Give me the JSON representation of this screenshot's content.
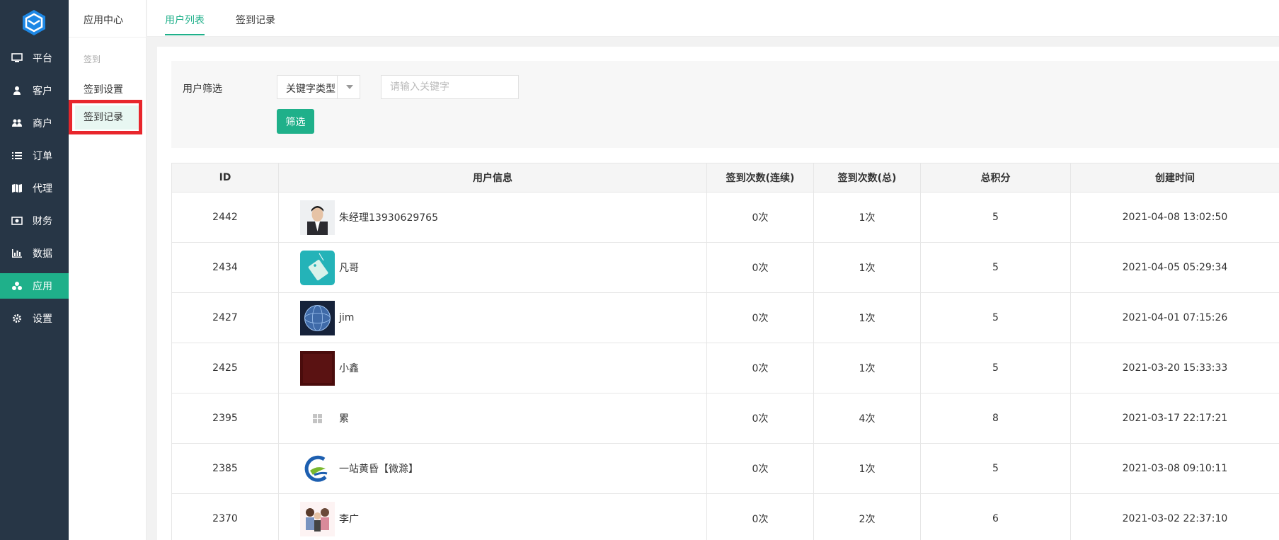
{
  "nav": {
    "items": [
      {
        "label": "平台",
        "icon": "monitor-icon"
      },
      {
        "label": "客户",
        "icon": "user-icon"
      },
      {
        "label": "商户",
        "icon": "users-icon"
      },
      {
        "label": "订单",
        "icon": "list-icon"
      },
      {
        "label": "代理",
        "icon": "map-icon"
      },
      {
        "label": "财务",
        "icon": "money-icon"
      },
      {
        "label": "数据",
        "icon": "bar-chart-icon"
      },
      {
        "label": "应用",
        "icon": "cubes-icon",
        "active": true
      },
      {
        "label": "设置",
        "icon": "gear-icon"
      }
    ]
  },
  "subnav": {
    "title": "应用中心",
    "group": "签到",
    "items": [
      {
        "label": "签到设置"
      },
      {
        "label": "签到记录",
        "active": true
      }
    ]
  },
  "tabs": [
    {
      "label": "用户列表",
      "active": true
    },
    {
      "label": "签到记录"
    }
  ],
  "filter": {
    "label": "用户筛选",
    "select_value": "关键字类型",
    "keyword_placeholder": "请输入关键字",
    "button_label": "筛选"
  },
  "table": {
    "headers": [
      "ID",
      "用户信息",
      "签到次数(连续)",
      "签到次数(总)",
      "总积分",
      "创建时间"
    ],
    "rows": [
      {
        "id": "2442",
        "name": "朱经理13930629765",
        "avatar": "portrait",
        "consecutive": "0次",
        "total": "1次",
        "points": "5",
        "created": "2021-04-08 13:02:50"
      },
      {
        "id": "2434",
        "name": "凡哥",
        "avatar": "tag",
        "consecutive": "0次",
        "total": "1次",
        "points": "5",
        "created": "2021-04-05 05:29:34"
      },
      {
        "id": "2427",
        "name": "jim",
        "avatar": "globe",
        "consecutive": "0次",
        "total": "1次",
        "points": "5",
        "created": "2021-04-01 07:15:26"
      },
      {
        "id": "2425",
        "name": "小鑫",
        "avatar": "dark-red",
        "consecutive": "0次",
        "total": "1次",
        "points": "5",
        "created": "2021-03-20 15:33:33"
      },
      {
        "id": "2395",
        "name": "累",
        "avatar": "placeholder",
        "consecutive": "0次",
        "total": "4次",
        "points": "8",
        "created": "2021-03-17 22:17:21"
      },
      {
        "id": "2385",
        "name": "一站黄昏【微滁】",
        "avatar": "logo",
        "consecutive": "0次",
        "total": "1次",
        "points": "5",
        "created": "2021-03-08 09:10:11"
      },
      {
        "id": "2370",
        "name": "李广",
        "avatar": "cartoon",
        "consecutive": "0次",
        "total": "2次",
        "points": "6",
        "created": "2021-03-02 22:37:10"
      }
    ]
  },
  "colors": {
    "nav_bg": "#273646",
    "accent": "#1fb08a",
    "highlight_box": "#e8262c"
  }
}
